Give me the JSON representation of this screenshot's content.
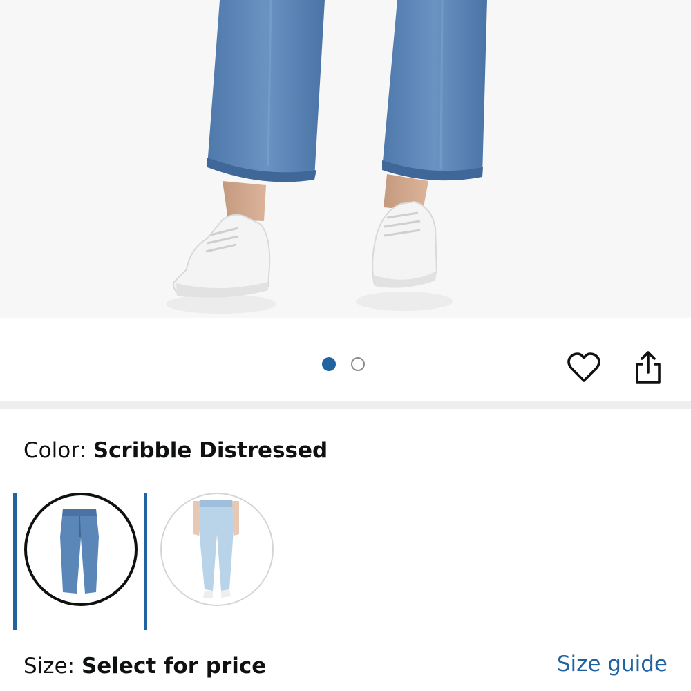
{
  "gallery": {
    "image_count": 2,
    "active_index": 0
  },
  "actions": {
    "wishlist_icon": "heart-icon",
    "share_icon": "share-icon"
  },
  "color": {
    "label": "Color: ",
    "value": "Scribble Distressed",
    "swatches": [
      {
        "name": "Scribble Distressed",
        "selected": true
      },
      {
        "name": "Light Wash",
        "selected": false
      }
    ]
  },
  "size": {
    "label": "Size: ",
    "value": "Select for price",
    "guide_link": "Size guide"
  },
  "colors": {
    "accent": "#2162a1",
    "text": "#0f1111",
    "divider": "#eeeeee",
    "denim_medium": "#5b86b8",
    "denim_light": "#b9d3e8"
  }
}
